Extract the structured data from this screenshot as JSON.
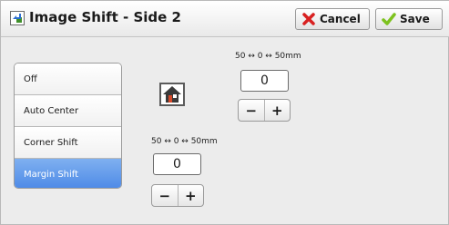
{
  "header": {
    "title": "Image Shift - Side 2",
    "cancel_label": "Cancel",
    "save_label": "Save"
  },
  "options": [
    {
      "label": "Off",
      "selected": false
    },
    {
      "label": "Auto Center",
      "selected": false
    },
    {
      "label": "Corner Shift",
      "selected": false
    },
    {
      "label": "Margin Shift",
      "selected": true
    }
  ],
  "vertical_shift": {
    "range_label": "50 ↔ 0 ↔ 50mm",
    "value": "0",
    "minus": "−",
    "plus": "+"
  },
  "horizontal_shift": {
    "range_label": "50 ↔ 0 ↔ 50mm",
    "value": "0",
    "minus": "−",
    "plus": "+"
  },
  "colors": {
    "selected_option": "#4b88e6",
    "cancel_icon": "#d82020",
    "save_icon": "#7dc21e"
  },
  "icons": {
    "title": "image-shift-icon",
    "cancel": "close-icon",
    "save": "checkmark-icon",
    "home": "home-icon"
  }
}
